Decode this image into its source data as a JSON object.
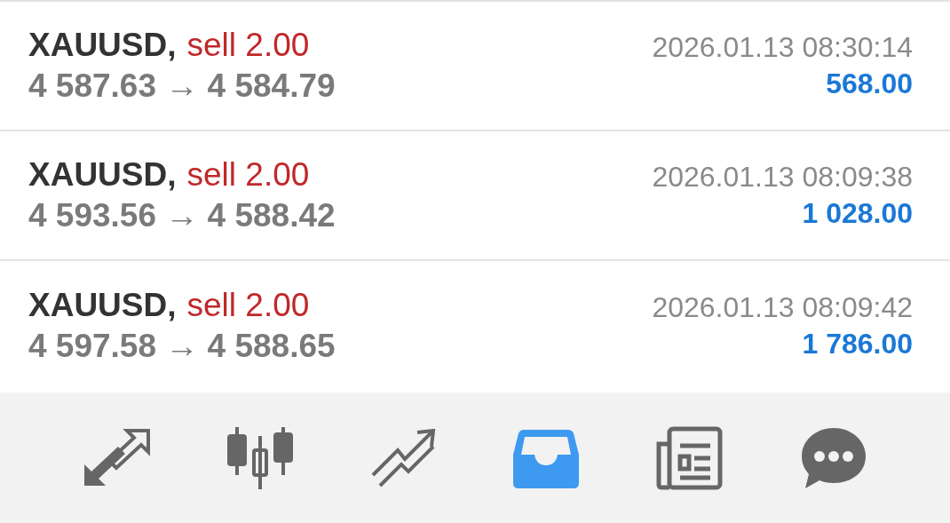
{
  "deals": [
    {
      "symbol": "XAUUSD,",
      "side": "sell 2.00",
      "prices": "4 587.63 → 4 584.79",
      "time": "2026.01.13 08:30:14",
      "profit": "568.00"
    },
    {
      "symbol": "XAUUSD,",
      "side": "sell 2.00",
      "prices": "4 593.56 → 4 588.42",
      "time": "2026.01.13 08:09:38",
      "profit": "1 028.00"
    },
    {
      "symbol": "XAUUSD,",
      "side": "sell 2.00",
      "prices": "4 597.58 → 4 588.65",
      "time": "2026.01.13 08:09:42",
      "profit": "1 786.00"
    }
  ],
  "tabs": [
    {
      "kind": "arrows",
      "selected": false
    },
    {
      "kind": "candles",
      "selected": false
    },
    {
      "kind": "chart",
      "selected": false
    },
    {
      "kind": "inbox",
      "selected": true
    },
    {
      "kind": "news",
      "selected": false
    },
    {
      "kind": "chat",
      "selected": false
    }
  ]
}
